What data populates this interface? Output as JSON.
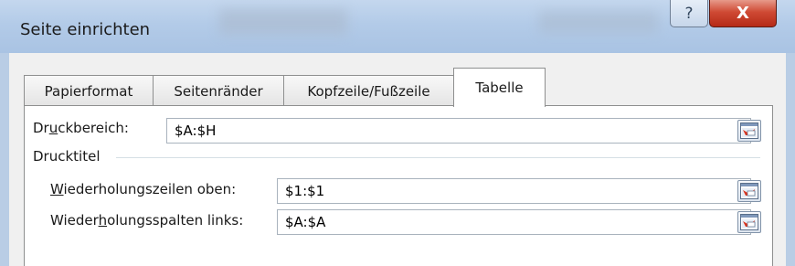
{
  "window": {
    "title": "Seite einrichten"
  },
  "title_buttons": {
    "help": "?",
    "close": "X"
  },
  "tabs": [
    {
      "label": "Papierformat"
    },
    {
      "label": "Seitenränder"
    },
    {
      "label": "Kopfzeile/Fußzeile"
    },
    {
      "label": "Tabelle",
      "active": true
    }
  ],
  "print_area": {
    "label_pre": "Dr",
    "label_mnemonic": "u",
    "label_post": "ckbereich:",
    "value": "$A:$H"
  },
  "print_titles": {
    "group_label": "Drucktitel",
    "rows_top": {
      "label_pre": "",
      "label_mnemonic": "W",
      "label_post": "iederholungszeilen oben:",
      "value": "$1:$1"
    },
    "cols_left": {
      "label_pre": "Wieder",
      "label_mnemonic": "h",
      "label_post": "olungsspalten links:",
      "value": "$A:$A"
    }
  },
  "icons": {
    "range_picker": "collapse-dialog-icon"
  }
}
